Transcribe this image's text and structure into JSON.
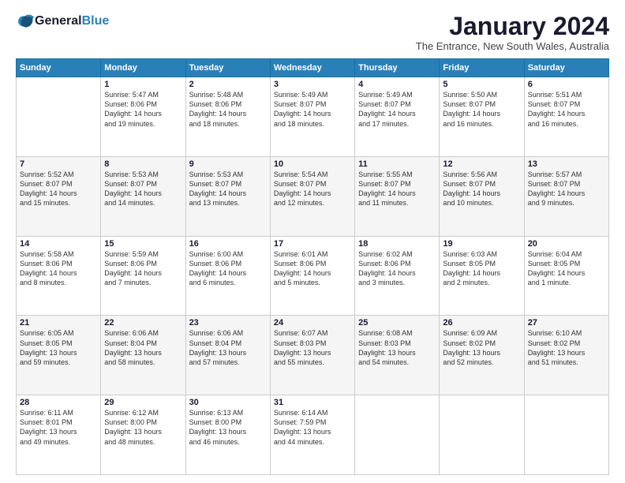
{
  "header": {
    "logo_text1": "General",
    "logo_text2": "Blue",
    "month": "January 2024",
    "location": "The Entrance, New South Wales, Australia"
  },
  "weekdays": [
    "Sunday",
    "Monday",
    "Tuesday",
    "Wednesday",
    "Thursday",
    "Friday",
    "Saturday"
  ],
  "weeks": [
    [
      {
        "day": "",
        "info": ""
      },
      {
        "day": "1",
        "info": "Sunrise: 5:47 AM\nSunset: 8:06 PM\nDaylight: 14 hours\nand 19 minutes."
      },
      {
        "day": "2",
        "info": "Sunrise: 5:48 AM\nSunset: 8:06 PM\nDaylight: 14 hours\nand 18 minutes."
      },
      {
        "day": "3",
        "info": "Sunrise: 5:49 AM\nSunset: 8:07 PM\nDaylight: 14 hours\nand 18 minutes."
      },
      {
        "day": "4",
        "info": "Sunrise: 5:49 AM\nSunset: 8:07 PM\nDaylight: 14 hours\nand 17 minutes."
      },
      {
        "day": "5",
        "info": "Sunrise: 5:50 AM\nSunset: 8:07 PM\nDaylight: 14 hours\nand 16 minutes."
      },
      {
        "day": "6",
        "info": "Sunrise: 5:51 AM\nSunset: 8:07 PM\nDaylight: 14 hours\nand 16 minutes."
      }
    ],
    [
      {
        "day": "7",
        "info": "Sunrise: 5:52 AM\nSunset: 8:07 PM\nDaylight: 14 hours\nand 15 minutes."
      },
      {
        "day": "8",
        "info": "Sunrise: 5:53 AM\nSunset: 8:07 PM\nDaylight: 14 hours\nand 14 minutes."
      },
      {
        "day": "9",
        "info": "Sunrise: 5:53 AM\nSunset: 8:07 PM\nDaylight: 14 hours\nand 13 minutes."
      },
      {
        "day": "10",
        "info": "Sunrise: 5:54 AM\nSunset: 8:07 PM\nDaylight: 14 hours\nand 12 minutes."
      },
      {
        "day": "11",
        "info": "Sunrise: 5:55 AM\nSunset: 8:07 PM\nDaylight: 14 hours\nand 11 minutes."
      },
      {
        "day": "12",
        "info": "Sunrise: 5:56 AM\nSunset: 8:07 PM\nDaylight: 14 hours\nand 10 minutes."
      },
      {
        "day": "13",
        "info": "Sunrise: 5:57 AM\nSunset: 8:07 PM\nDaylight: 14 hours\nand 9 minutes."
      }
    ],
    [
      {
        "day": "14",
        "info": "Sunrise: 5:58 AM\nSunset: 8:06 PM\nDaylight: 14 hours\nand 8 minutes."
      },
      {
        "day": "15",
        "info": "Sunrise: 5:59 AM\nSunset: 8:06 PM\nDaylight: 14 hours\nand 7 minutes."
      },
      {
        "day": "16",
        "info": "Sunrise: 6:00 AM\nSunset: 8:06 PM\nDaylight: 14 hours\nand 6 minutes."
      },
      {
        "day": "17",
        "info": "Sunrise: 6:01 AM\nSunset: 8:06 PM\nDaylight: 14 hours\nand 5 minutes."
      },
      {
        "day": "18",
        "info": "Sunrise: 6:02 AM\nSunset: 8:06 PM\nDaylight: 14 hours\nand 3 minutes."
      },
      {
        "day": "19",
        "info": "Sunrise: 6:03 AM\nSunset: 8:05 PM\nDaylight: 14 hours\nand 2 minutes."
      },
      {
        "day": "20",
        "info": "Sunrise: 6:04 AM\nSunset: 8:05 PM\nDaylight: 14 hours\nand 1 minute."
      }
    ],
    [
      {
        "day": "21",
        "info": "Sunrise: 6:05 AM\nSunset: 8:05 PM\nDaylight: 13 hours\nand 59 minutes."
      },
      {
        "day": "22",
        "info": "Sunrise: 6:06 AM\nSunset: 8:04 PM\nDaylight: 13 hours\nand 58 minutes."
      },
      {
        "day": "23",
        "info": "Sunrise: 6:06 AM\nSunset: 8:04 PM\nDaylight: 13 hours\nand 57 minutes."
      },
      {
        "day": "24",
        "info": "Sunrise: 6:07 AM\nSunset: 8:03 PM\nDaylight: 13 hours\nand 55 minutes."
      },
      {
        "day": "25",
        "info": "Sunrise: 6:08 AM\nSunset: 8:03 PM\nDaylight: 13 hours\nand 54 minutes."
      },
      {
        "day": "26",
        "info": "Sunrise: 6:09 AM\nSunset: 8:02 PM\nDaylight: 13 hours\nand 52 minutes."
      },
      {
        "day": "27",
        "info": "Sunrise: 6:10 AM\nSunset: 8:02 PM\nDaylight: 13 hours\nand 51 minutes."
      }
    ],
    [
      {
        "day": "28",
        "info": "Sunrise: 6:11 AM\nSunset: 8:01 PM\nDaylight: 13 hours\nand 49 minutes."
      },
      {
        "day": "29",
        "info": "Sunrise: 6:12 AM\nSunset: 8:00 PM\nDaylight: 13 hours\nand 48 minutes."
      },
      {
        "day": "30",
        "info": "Sunrise: 6:13 AM\nSunset: 8:00 PM\nDaylight: 13 hours\nand 46 minutes."
      },
      {
        "day": "31",
        "info": "Sunrise: 6:14 AM\nSunset: 7:59 PM\nDaylight: 13 hours\nand 44 minutes."
      },
      {
        "day": "",
        "info": ""
      },
      {
        "day": "",
        "info": ""
      },
      {
        "day": "",
        "info": ""
      }
    ]
  ]
}
